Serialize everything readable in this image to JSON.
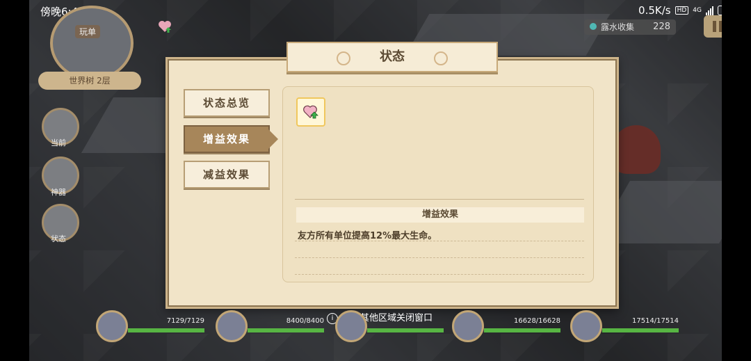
{
  "status_bar": {
    "time": "傍晚6:49",
    "net_speed": "0.5K/s",
    "hd_badge": "HD",
    "network": "4G",
    "battery": "31"
  },
  "hud": {
    "minimap_label": "玩单",
    "floor_label": "世界树 2层",
    "side_buttons": [
      {
        "label": "当前",
        "icon": "location-pin-icon"
      },
      {
        "label": "神器",
        "icon": "artifact-icon"
      },
      {
        "label": "状态",
        "icon": "status-icon"
      }
    ],
    "treasure_label": "露水收集",
    "treasure_value": "228"
  },
  "dialog": {
    "title": "状态",
    "tabs": [
      {
        "label": "状态总览",
        "active": false
      },
      {
        "label": "增益效果",
        "active": true
      },
      {
        "label": "减益效果",
        "active": false
      }
    ],
    "buff_icon": "heart-up-icon",
    "desc_title": "增益效果",
    "desc_text": "友方所有单位提高12%最大生命。"
  },
  "close_hint": "点击其他区域关闭窗口",
  "party": [
    {
      "hp": "7129/7129",
      "hp_fraction": 1.0
    },
    {
      "hp": "8400/8400",
      "hp_fraction": 1.0
    },
    {
      "hp": "",
      "hp_fraction": 1.0
    },
    {
      "hp": "16628/16628",
      "hp_fraction": 1.0
    },
    {
      "hp": "17514/17514",
      "hp_fraction": 1.0
    }
  ],
  "colors": {
    "dialog_bg": "#f1e4c8",
    "active_tab": "#a7865a",
    "hp_green": "#57b543"
  }
}
